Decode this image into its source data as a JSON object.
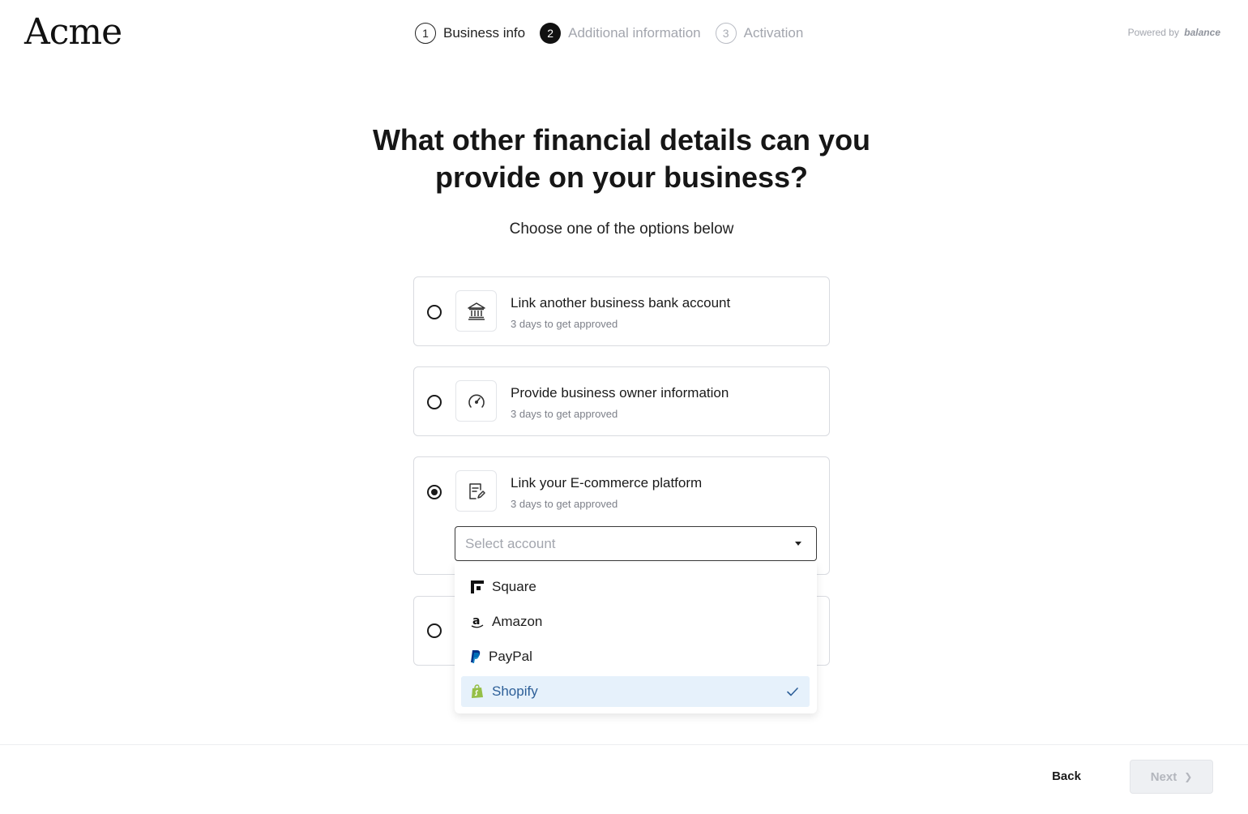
{
  "header": {
    "logo": "Acme",
    "powered_by_prefix": "Powered by",
    "powered_by_brand": "balance",
    "steps": [
      {
        "number": "1",
        "label": "Business info",
        "state": "done"
      },
      {
        "number": "2",
        "label": "Additional information",
        "state": "active"
      },
      {
        "number": "3",
        "label": "Activation",
        "state": "future"
      }
    ]
  },
  "main": {
    "title_line1": "What other financial details can you",
    "title_line2": "provide on your business?",
    "subtitle": "Choose one of the options below",
    "options": [
      {
        "title": "Link another business bank account",
        "subtitle": "3 days to get approved",
        "icon": "bank-icon",
        "selected": false
      },
      {
        "title": "Provide business owner information",
        "subtitle": "3 days to get approved",
        "icon": "speedometer-icon",
        "selected": false
      },
      {
        "title": "Link your E-commerce platform",
        "subtitle": "3 days to get approved",
        "icon": "document-edit-icon",
        "selected": true
      }
    ],
    "select": {
      "placeholder": "Select account",
      "options": [
        {
          "label": "Square",
          "icon": "square-logo-icon"
        },
        {
          "label": "Amazon",
          "icon": "amazon-logo-icon"
        },
        {
          "label": "PayPal",
          "icon": "paypal-logo-icon"
        },
        {
          "label": "Shopify",
          "icon": "shopify-logo-icon",
          "selected": true
        }
      ]
    }
  },
  "footer": {
    "back_label": "Back",
    "next_label": "Next"
  },
  "colors": {
    "accent_selected_bg": "#e6f1fb",
    "accent_selected_text": "#2d5f98",
    "muted_text": "#a3a6ae",
    "shopify_green": "#95bf47",
    "paypal_blue": "#003087"
  }
}
